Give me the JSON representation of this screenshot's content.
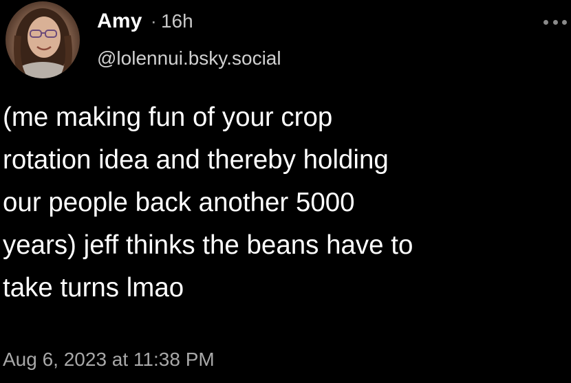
{
  "post": {
    "author": {
      "name": "Amy",
      "separator": "·",
      "relative_time": "16h",
      "handle": "@lolennui.bsky.social",
      "avatar_icon": "user-avatar-photo"
    },
    "more_icon": "more-horizontal-icon",
    "text": "(me making fun of your crop\nrotation idea and thereby holding\nour people back another 5000\nyears) jeff thinks the beans have to\ntake turns lmao",
    "date": "Aug 6, 2023 at 11:38 PM"
  },
  "colors": {
    "background": "#000000",
    "primary_text": "#ffffff",
    "secondary_text": "#a8a8a8"
  }
}
